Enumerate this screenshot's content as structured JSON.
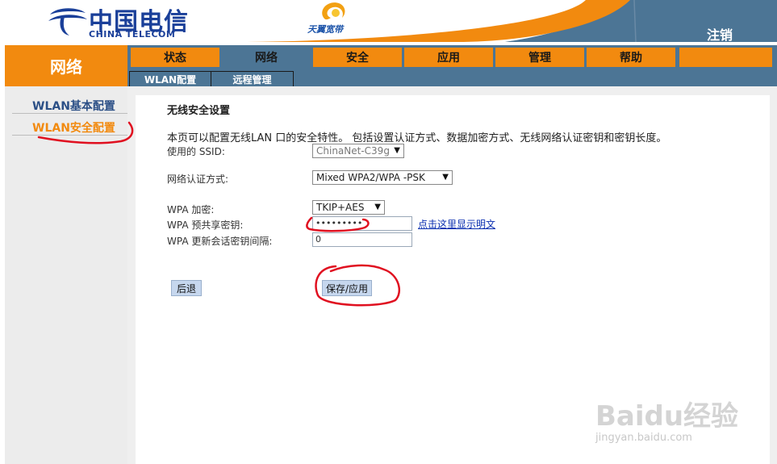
{
  "header": {
    "logo_cn": "中国电信",
    "logo_en": "CHINA TELECOM",
    "brand": "天翼宽带",
    "logout": "注销"
  },
  "nav": {
    "section": "网络",
    "tabs": [
      {
        "label": "状态"
      },
      {
        "label": "网络"
      },
      {
        "label": "安全"
      },
      {
        "label": "应用"
      },
      {
        "label": "管理"
      },
      {
        "label": "帮助"
      }
    ],
    "subtabs": [
      {
        "label": "WLAN配置"
      },
      {
        "label": "远程管理"
      }
    ]
  },
  "sidebar": {
    "items": [
      {
        "label": "WLAN基本配置"
      },
      {
        "label": "WLAN安全配置"
      }
    ]
  },
  "form": {
    "title": "无线安全设置",
    "description": "本页可以配置无线LAN 口的安全特性。 包括设置认证方式、数据加密方式、无线网络认证密钥和密钥长度。",
    "ssid_label": "使用的 SSID:",
    "ssid_value": "ChinaNet-C39g",
    "auth_label": "网络认证方式:",
    "auth_value": "Mixed WPA2/WPA -PSK",
    "encrypt_label": "WPA 加密:",
    "encrypt_value": "TKIP+AES",
    "psk_label": "WPA 预共享密钥:",
    "psk_value": "•••••••••",
    "show_plain": "点击这里显示明文",
    "rekey_label": "WPA 更新会话密钥间隔:",
    "rekey_value": "0",
    "back_button": "后退",
    "save_button": "保存/应用"
  },
  "watermark": {
    "main": "Baidu经验",
    "sub": "jingyan.baidu.com"
  },
  "colors": {
    "orange": "#f28a0f",
    "nav_blue": "#4c7595",
    "link_blue": "#0b2fb0",
    "annotation_red": "#e01020"
  }
}
